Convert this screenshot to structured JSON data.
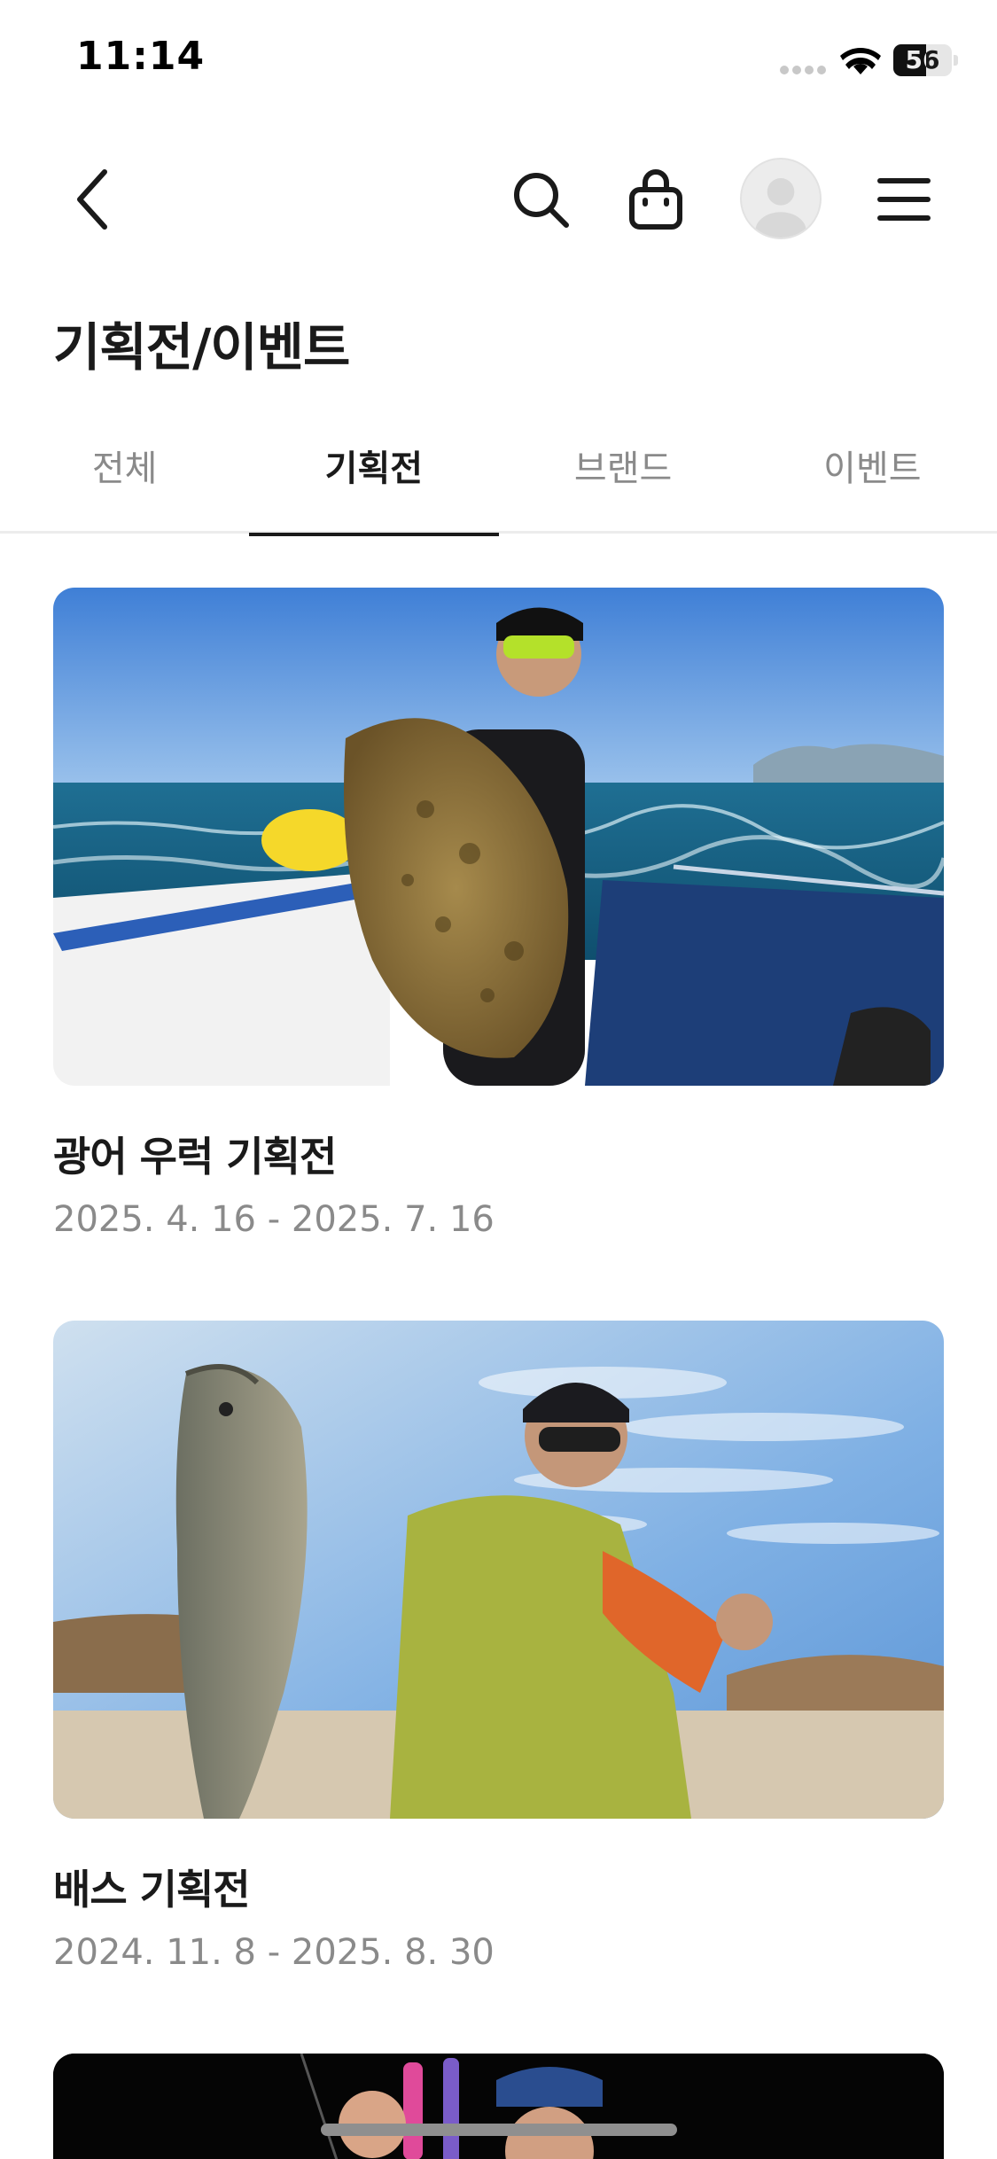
{
  "status_bar": {
    "time": "11:14",
    "battery": "56",
    "battery_level_percent": 56
  },
  "nav": {
    "back_icon": "chevron-left-icon",
    "search_icon": "search-icon",
    "bag_icon": "shopping-bag-icon",
    "avatar_icon": "user-avatar-icon",
    "menu_icon": "hamburger-menu-icon"
  },
  "page": {
    "title": "기획전/이벤트"
  },
  "tabs": [
    {
      "label": "전체",
      "active": false
    },
    {
      "label": "기획전",
      "active": true
    },
    {
      "label": "브랜드",
      "active": false
    },
    {
      "label": "이벤트",
      "active": false
    }
  ],
  "promotions": [
    {
      "title": "광어 우럭 기획전",
      "period": "2025. 4. 16 - 2025. 7. 16",
      "image": "angler-holding-flounder-on-boat"
    },
    {
      "title": "배스 기획전",
      "period": "2024. 11. 8 - 2025. 8. 30",
      "image": "angler-holding-bass-under-cloudy-sky"
    },
    {
      "title": "",
      "period": "",
      "image": "angler-with-lures-dark-background"
    }
  ],
  "colors": {
    "text_primary": "#1a1a1a",
    "text_secondary": "#8a8a8a",
    "tab_underline": "#1a1a1a",
    "divider": "#ececec"
  }
}
